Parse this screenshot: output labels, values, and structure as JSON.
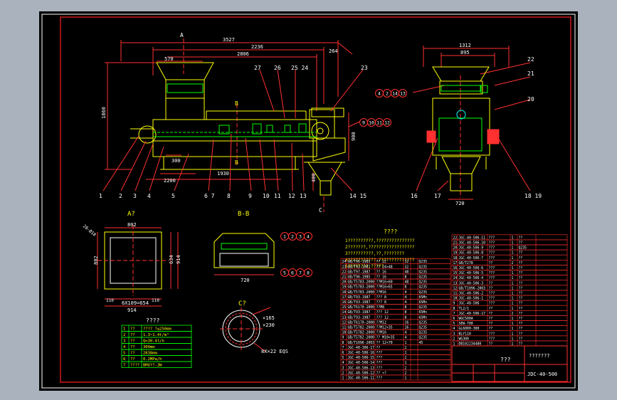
{
  "colors": {
    "background": "#000000",
    "border": "#ff2020",
    "yellow": "#ffff00",
    "green": "#00ff00",
    "cyan": "#00ffff",
    "red": "#ff3030",
    "white": "#ffffff",
    "magenta": "#ff00ff",
    "blue": "#2060ff"
  },
  "views": {
    "main": {
      "section_a": "A",
      "section_c": "C",
      "section_b": "B",
      "dims": {
        "overall": "3527",
        "d2236": "2236",
        "d2806": "2806",
        "d264": "264",
        "d570": "570",
        "height": "1860",
        "d300": "300",
        "d2200": "2200",
        "d1930": "1930",
        "d900": "900",
        "d400": "400"
      },
      "callouts_bottom": [
        "1",
        "2",
        "3",
        "4",
        "5",
        "6 7",
        "8",
        "9",
        "10",
        "11",
        "12",
        "13",
        "14 15"
      ],
      "callouts_top": [
        "27",
        "26",
        "25 24",
        "23"
      ],
      "circles": [
        "9",
        "10",
        "11",
        "12"
      ]
    },
    "side": {
      "dims": {
        "width": "1312",
        "d895": "895",
        "bottom": "720"
      },
      "callouts": [
        "22",
        "21",
        "20",
        "16",
        "17",
        "18 19"
      ],
      "circles": [
        "4",
        "2",
        "14",
        "13"
      ]
    },
    "view_a": {
      "title": "A?",
      "dims": {
        "top": "802",
        "left": "802",
        "bottom": "914",
        "r1": "634",
        "r2": "914",
        "bolts": "6X109=654",
        "d110a": "110",
        "d110b": "110",
        "note": "28-Ø18"
      }
    },
    "view_b": {
      "title": "B-B",
      "dim": "720",
      "circles_top": [
        "1",
        "2",
        "3",
        "4"
      ],
      "circles_bottom": [
        "5",
        "6",
        "7",
        "8"
      ]
    },
    "view_c": {
      "title": "C?",
      "dims": {
        "d1": "×165",
        "d2": "×230",
        "d3": "8X×22 EQS"
      }
    }
  },
  "notes": {
    "title": "????",
    "lines": [
      "1??????????,???????????????",
      "2???????,??????????????????",
      "3??????????,??,????????",
      "4???????????,??????????????",
      "5????????,?????"
    ]
  },
  "spec_table": {
    "title": "????",
    "rows": [
      [
        "1",
        "??",
        "???? ?≤250mm"
      ],
      [
        "2",
        "??",
        "1.3~1.4t/m³"
      ],
      [
        "3",
        "??",
        "Q=30.4t/h"
      ],
      [
        "4",
        "??",
        "300mm"
      ],
      [
        "5",
        "??",
        "2838mm"
      ],
      [
        "6",
        "??",
        "0.2MPa/h"
      ],
      [
        "7",
        "????",
        "BMU??-3W"
      ]
    ]
  },
  "parts_left": [
    [
      "24",
      "GB/T96-1985",
      "?? 22",
      "32",
      "",
      "Q235"
    ],
    [
      "23",
      "GB/T93-1987",
      "?? 24×48",
      "32",
      "",
      "Q235"
    ],
    [
      "22",
      "GB/T97-1987",
      "?? 16",
      "48",
      "",
      "Q235"
    ],
    [
      "21",
      "GB/T96-1985",
      "?? 16",
      "8",
      "",
      "Q235"
    ],
    [
      "20",
      "GB/T5783-2000",
      "??M16×60",
      "48",
      "",
      "Q235"
    ],
    [
      "19",
      "GB/T5783-2000",
      "??M16×65",
      "8",
      "",
      "Q235"
    ],
    [
      "18",
      "GB/T5783-2000",
      "??M16",
      "4",
      "",
      "Q235"
    ],
    [
      "17",
      "GB/T93-1987",
      "??? 8",
      "4",
      "",
      "65Mn"
    ],
    [
      "16",
      "GB/T93-1987",
      "??? 8",
      "4",
      "",
      "65Mn"
    ],
    [
      "15",
      "GB/T6170-2000",
      "??M8",
      "8",
      "",
      "Q235"
    ],
    [
      "14",
      "GB/T93-1987",
      "??? 12",
      "8",
      "",
      "65Mn"
    ],
    [
      "13",
      "GB/T93-1987",
      "??? 12",
      "8",
      "",
      "65Mn"
    ],
    [
      "12",
      "GB/T6170-2000",
      "??M12",
      "16",
      "",
      "Q235"
    ],
    [
      "11",
      "GB/T5782-2000",
      "??M12×35",
      "16",
      "",
      "Q235"
    ],
    [
      "10",
      "GB/T5782-2000",
      "??M16",
      "4",
      "",
      "Q235"
    ],
    [
      "9",
      "GB/T5782-2000",
      "?? M10×35",
      "4",
      "",
      "Q235"
    ],
    [
      "8",
      "GB/T1096-2003",
      "?? 12×70",
      "1",
      "",
      "45"
    ],
    [
      "7",
      "JGC-40-306-17",
      "??",
      "2",
      "",
      ""
    ],
    [
      "6",
      "JGC-40-506-16",
      "???",
      "1",
      "",
      ""
    ],
    [
      "5",
      "JGC-40-506-15",
      "???",
      "2",
      "",
      ""
    ],
    [
      "4",
      "JGC-40-506-14",
      "???",
      "1",
      "",
      ""
    ],
    [
      "3",
      "JGC-40-506-13",
      "???",
      "2",
      "",
      ""
    ],
    [
      "2",
      "JGC-40-506-12",
      "?? ×?",
      "2",
      "",
      ""
    ],
    [
      "1",
      "JGC-40-506-11",
      "???",
      "1",
      "",
      ""
    ]
  ],
  "parts_right": [
    [
      "22",
      "JGC-40-506-11",
      "???",
      "1",
      "??",
      ""
    ],
    [
      "21",
      "JGC-40-506-10",
      "???",
      "1",
      "??",
      ""
    ],
    [
      "20",
      "JGC-40-506-9",
      "???",
      "1",
      "Q235",
      ""
    ],
    [
      "19",
      "JGC-40-506-8",
      "???",
      "1",
      "??",
      ""
    ],
    [
      "18",
      "JGC-40-506-7",
      "???",
      "1",
      "??",
      ""
    ],
    [
      "17",
      "GB/T278",
      "??",
      "2",
      "??",
      ""
    ],
    [
      "16",
      "JGC-40-506-6",
      "???",
      "1",
      "??",
      ""
    ],
    [
      "15",
      "JGC-40-506-5",
      "???",
      "1",
      "??",
      ""
    ],
    [
      "14",
      "JGC-40-506-4",
      "???",
      "1",
      "??",
      ""
    ],
    [
      "13",
      "JGC-40-506-3",
      "??",
      "1",
      "??",
      ""
    ],
    [
      "12",
      "GB/T1096-2003",
      "??",
      "1",
      "??",
      ""
    ],
    [
      "11",
      "JGC-40-506-2",
      "???",
      "1",
      "??",
      ""
    ],
    [
      "10",
      "JGC-40-506-1",
      "???",
      "1",
      "??",
      ""
    ],
    [
      "9",
      "JGC-40-506",
      "???",
      "1",
      "??",
      ""
    ],
    [
      "8",
      "TL2/1",
      "??",
      "1",
      "??",
      ""
    ],
    [
      "7",
      "JGC-40-506-17",
      "??",
      "2",
      "??",
      ""
    ],
    [
      "6",
      "WGC500A",
      "??",
      "1",
      "??",
      ""
    ],
    [
      "5",
      "SEW-700",
      "??",
      "1",
      "??",
      ""
    ],
    [
      "4",
      "GL6000-300",
      "??",
      "1",
      "??",
      ""
    ],
    [
      "3",
      "BLY110",
      "???",
      "1",
      "??",
      ""
    ],
    [
      "2",
      "WG300",
      "???",
      "1",
      "??",
      ""
    ],
    [
      "1",
      "DB102234480",
      "??",
      "1",
      "??",
      ""
    ]
  ],
  "title_block": {
    "name": "???",
    "drawing_no": "JDC-40-500",
    "project": "???????"
  }
}
